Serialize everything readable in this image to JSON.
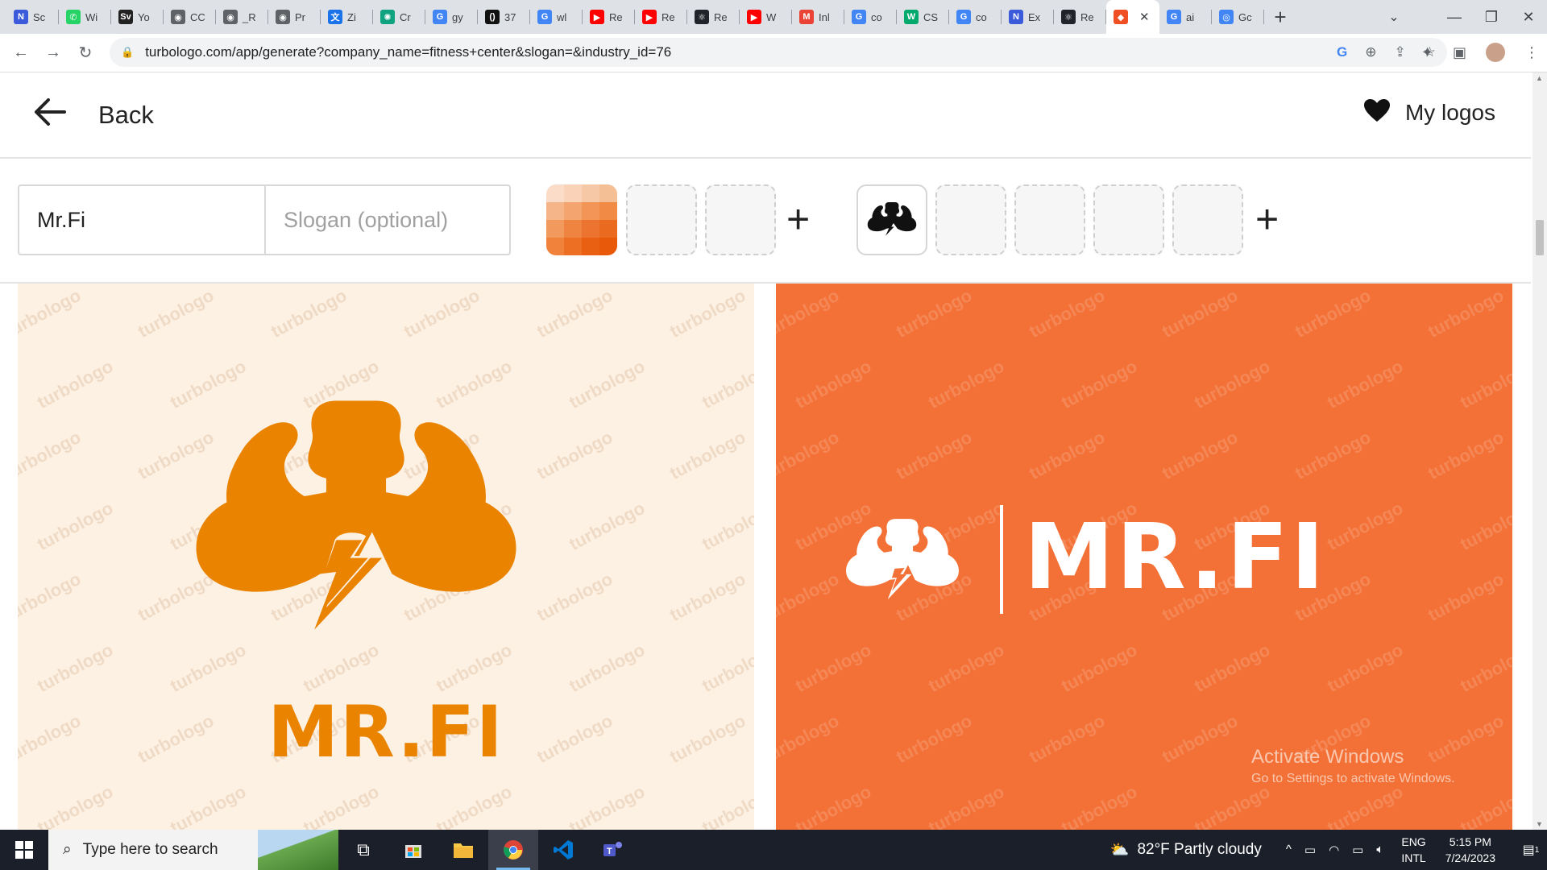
{
  "browser": {
    "tabs": [
      {
        "label": "Sc",
        "icon": "n-icon",
        "color": "#3b5bdb"
      },
      {
        "label": "Wi",
        "icon": "whatsapp-icon",
        "color": "#25d366"
      },
      {
        "label": "Yo",
        "icon": "sv-icon",
        "color": "#222222"
      },
      {
        "label": "CC",
        "icon": "globe-icon",
        "color": "#5f6368"
      },
      {
        "label": "_R",
        "icon": "globe-icon",
        "color": "#5f6368"
      },
      {
        "label": "Pr",
        "icon": "globe-icon",
        "color": "#5f6368"
      },
      {
        "label": "Zi",
        "icon": "translate-icon",
        "color": "#1a73e8"
      },
      {
        "label": "Cr",
        "icon": "chatgpt-icon",
        "color": "#10a37f"
      },
      {
        "label": "gy",
        "icon": "google-icon",
        "color": "#4285f4"
      },
      {
        "label": "37",
        "icon": "bracket-icon",
        "color": "#111111"
      },
      {
        "label": "wl",
        "icon": "google-icon",
        "color": "#4285f4"
      },
      {
        "label": "Re",
        "icon": "youtube-icon",
        "color": "#ff0000"
      },
      {
        "label": "Re",
        "icon": "youtube-icon",
        "color": "#ff0000"
      },
      {
        "label": "Re",
        "icon": "react-icon",
        "color": "#20232a"
      },
      {
        "label": "W",
        "icon": "youtube-icon",
        "color": "#ff0000"
      },
      {
        "label": "Inl",
        "icon": "gmail-icon",
        "color": "#ea4335"
      },
      {
        "label": "co",
        "icon": "google-icon",
        "color": "#4285f4"
      },
      {
        "label": "CS",
        "icon": "w3-icon",
        "color": "#04aa6d"
      },
      {
        "label": "co",
        "icon": "google-icon",
        "color": "#4285f4"
      },
      {
        "label": "Ex",
        "icon": "n-icon",
        "color": "#3b5bdb"
      },
      {
        "label": "Re",
        "icon": "react-icon",
        "color": "#20232a"
      },
      {
        "label": "",
        "icon": "turbologo-icon",
        "color": "#f04e23",
        "active": true
      },
      {
        "label": "ai",
        "icon": "google-icon",
        "color": "#4285f4"
      },
      {
        "label": "Gc",
        "icon": "lens-icon",
        "color": "#4285f4"
      }
    ],
    "url": "turbologo.com/app/generate?company_name=fitness+center&slogan=&industry_id=76",
    "new_tab_label": "+",
    "tab_close_label": "✕"
  },
  "header": {
    "back_label": "Back",
    "my_logos_label": "My logos"
  },
  "editor": {
    "company_name": "Mr.Fi",
    "slogan_placeholder": "Slogan (optional)",
    "add_color_label": "+",
    "add_icon_label": "+",
    "palette_colors": [
      "#fbdcc8",
      "#f9d2b8",
      "#f7c8a6",
      "#f5bf95",
      "#f6b589",
      "#f4a46e",
      "#f29556",
      "#f08a45",
      "#f29a5e",
      "#ef8340",
      "#ec7330",
      "#ea6a1f",
      "#f0823b",
      "#ec6f24",
      "#e96012",
      "#e85a09"
    ]
  },
  "results": [
    {
      "logo_text": "MR.FI",
      "background": "#fdf1e3",
      "color": "#ea8300",
      "watermark": "turbologo"
    },
    {
      "logo_text": "MR.FI",
      "background": "#f37136",
      "color": "#ffffff",
      "watermark": "turbologo"
    }
  ],
  "system_overlay": {
    "activate_title": "Activate Windows",
    "activate_sub": "Go to Settings to activate Windows."
  },
  "taskbar": {
    "search_placeholder": "Type here to search",
    "weather": "82°F  Partly cloudy",
    "lang_top": "ENG",
    "lang_bottom": "INTL",
    "time": "5:15 PM",
    "date": "7/24/2023",
    "notifications": "1"
  }
}
